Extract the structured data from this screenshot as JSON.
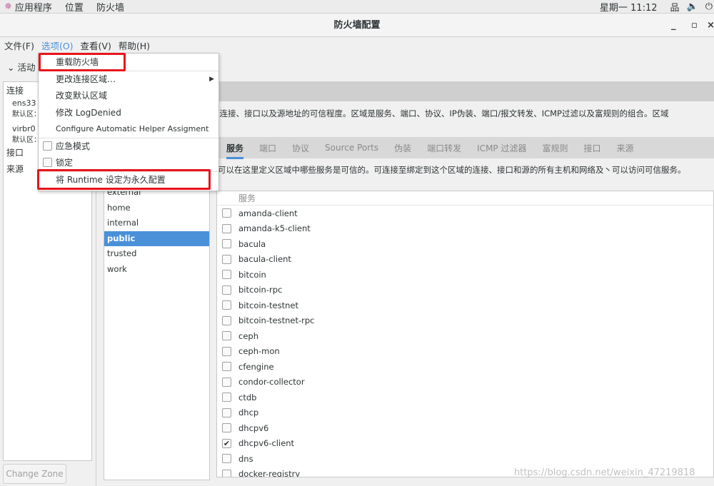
{
  "topbar": {
    "apps": "应用程序",
    "places": "位置",
    "firewall": "防火墙",
    "clock": "星期一 11:12"
  },
  "window": {
    "title": "防火墙配置",
    "minimize": "_",
    "maximize": "▫",
    "close": "×"
  },
  "menubar": [
    "文件(F)",
    "选项(O)",
    "查看(V)",
    "帮助(H)"
  ],
  "active_bindings": {
    "header": "活动",
    "connections": "连接",
    "conn1_name": "ens33 (",
    "conn1_zone": "默认区：",
    "conn2_name": "virbr0 (",
    "conn2_zone": "默认区：",
    "interfaces": "接口",
    "sources": "来源",
    "change_zone": "Change Zone"
  },
  "options_menu": {
    "items": [
      "重载防火墙",
      "更改连接区域…",
      "改变默认区域",
      "修改 LogDenied",
      "Configure Automatic Helper Assigment"
    ],
    "checks": [
      {
        "label": "应急模式",
        "checked": false
      },
      {
        "label": "锁定",
        "checked": false
      }
    ],
    "runtime_to_permanent": "将 Runtime 设定为永久配置"
  },
  "zone_description": "络连接、接口以及源地址的可信程度。区域是服务、端口、协议、IP伪装、端口/报文转发、ICMP过滤以及富规则的组合。区域",
  "tabs": [
    "服务",
    "端口",
    "协议",
    "Source Ports",
    "伪装",
    "端口转发",
    "ICMP 过滤器",
    "富规则",
    "接口",
    "来源"
  ],
  "active_tab": "服务",
  "services_description": "可以在这里定义区域中哪些服务是可信的。可连接至绑定到这个区域的连接、接口和源的所有主机和网络及丶可以访问可信服务。",
  "zones": [
    "external",
    "home",
    "internal",
    "public",
    "trusted",
    "work"
  ],
  "selected_zone": "public",
  "services_header": "服务",
  "services": [
    {
      "name": "amanda-client",
      "checked": false
    },
    {
      "name": "amanda-k5-client",
      "checked": false
    },
    {
      "name": "bacula",
      "checked": false
    },
    {
      "name": "bacula-client",
      "checked": false
    },
    {
      "name": "bitcoin",
      "checked": false
    },
    {
      "name": "bitcoin-rpc",
      "checked": false
    },
    {
      "name": "bitcoin-testnet",
      "checked": false
    },
    {
      "name": "bitcoin-testnet-rpc",
      "checked": false
    },
    {
      "name": "ceph",
      "checked": false
    },
    {
      "name": "ceph-mon",
      "checked": false
    },
    {
      "name": "cfengine",
      "checked": false
    },
    {
      "name": "condor-collector",
      "checked": false
    },
    {
      "name": "ctdb",
      "checked": false
    },
    {
      "name": "dhcp",
      "checked": false
    },
    {
      "name": "dhcpv6",
      "checked": false
    },
    {
      "name": "dhcpv6-client",
      "checked": true
    },
    {
      "name": "dns",
      "checked": false
    },
    {
      "name": "docker-registry",
      "checked": false
    }
  ],
  "watermark": "https://blog.csdn.net/weixin_47219818",
  "colors": {
    "accent": "#4a90d9",
    "highlight_box": "#e8141c"
  }
}
